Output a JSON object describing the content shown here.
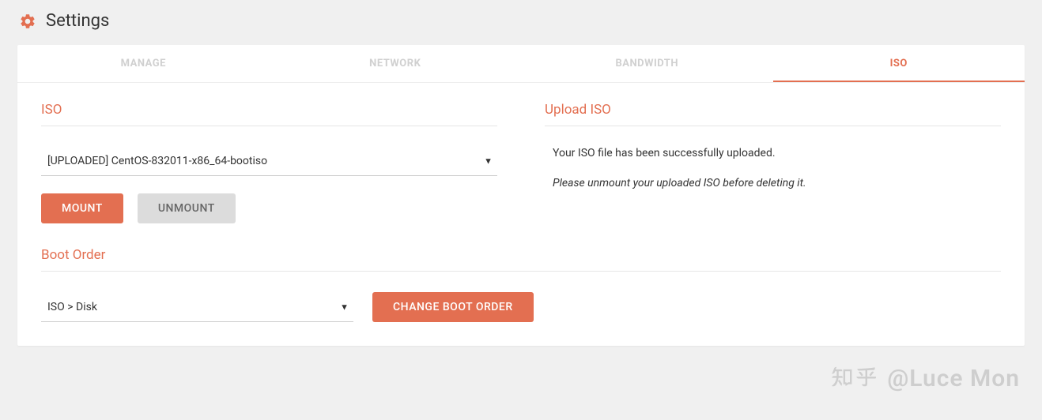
{
  "page": {
    "title": "Settings"
  },
  "tabs": [
    {
      "label": "MANAGE",
      "active": false
    },
    {
      "label": "NETWORK",
      "active": false
    },
    {
      "label": "BANDWIDTH",
      "active": false
    },
    {
      "label": "ISO",
      "active": true
    }
  ],
  "iso": {
    "section_title": "ISO",
    "selected": "[UPLOADED] CentOS-832011-x86_64-bootiso",
    "mount_label": "MOUNT",
    "unmount_label": "UNMOUNT"
  },
  "upload": {
    "section_title": "Upload ISO",
    "message": "Your ISO file has been successfully uploaded.",
    "note": "Please unmount your uploaded ISO before deleting it."
  },
  "boot": {
    "section_title": "Boot Order",
    "selected": "ISO > Disk",
    "change_label": "CHANGE BOOT ORDER"
  },
  "watermark": {
    "text": "@Luce Mon"
  }
}
